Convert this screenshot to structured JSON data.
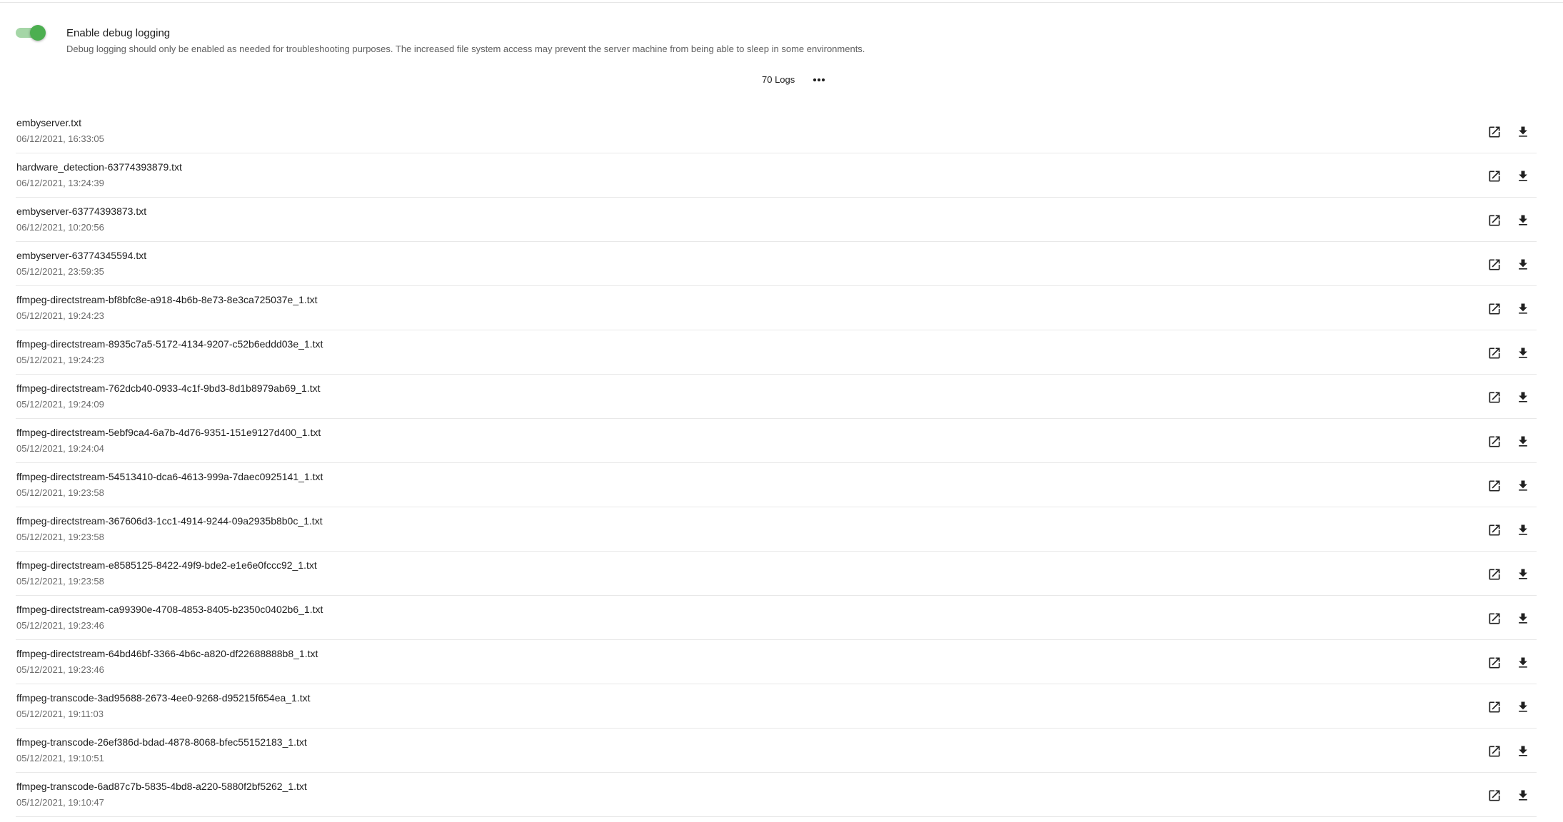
{
  "debug": {
    "enabled": true,
    "label": "Enable debug logging",
    "help": "Debug logging should only be enabled as needed for troubleshooting purposes. The increased file system access may prevent the server machine from being able to sleep in some environments."
  },
  "logs_header": {
    "count_label": "70 Logs",
    "more_icon": "more-horizontal-icon"
  },
  "colors": {
    "toggle_on": "#4caf50",
    "toggle_track": "#a5d6a7"
  },
  "row_icons": {
    "open": "open-in-new-icon",
    "download": "download-icon"
  },
  "logs": [
    {
      "name": "embyserver.txt",
      "date": "06/12/2021, 16:33:05"
    },
    {
      "name": "hardware_detection-63774393879.txt",
      "date": "06/12/2021, 13:24:39"
    },
    {
      "name": "embyserver-63774393873.txt",
      "date": "06/12/2021, 10:20:56"
    },
    {
      "name": "embyserver-63774345594.txt",
      "date": "05/12/2021, 23:59:35"
    },
    {
      "name": "ffmpeg-directstream-bf8bfc8e-a918-4b6b-8e73-8e3ca725037e_1.txt",
      "date": "05/12/2021, 19:24:23"
    },
    {
      "name": "ffmpeg-directstream-8935c7a5-5172-4134-9207-c52b6eddd03e_1.txt",
      "date": "05/12/2021, 19:24:23"
    },
    {
      "name": "ffmpeg-directstream-762dcb40-0933-4c1f-9bd3-8d1b8979ab69_1.txt",
      "date": "05/12/2021, 19:24:09"
    },
    {
      "name": "ffmpeg-directstream-5ebf9ca4-6a7b-4d76-9351-151e9127d400_1.txt",
      "date": "05/12/2021, 19:24:04"
    },
    {
      "name": "ffmpeg-directstream-54513410-dca6-4613-999a-7daec0925141_1.txt",
      "date": "05/12/2021, 19:23:58"
    },
    {
      "name": "ffmpeg-directstream-367606d3-1cc1-4914-9244-09a2935b8b0c_1.txt",
      "date": "05/12/2021, 19:23:58"
    },
    {
      "name": "ffmpeg-directstream-e8585125-8422-49f9-bde2-e1e6e0fccc92_1.txt",
      "date": "05/12/2021, 19:23:58"
    },
    {
      "name": "ffmpeg-directstream-ca99390e-4708-4853-8405-b2350c0402b6_1.txt",
      "date": "05/12/2021, 19:23:46"
    },
    {
      "name": "ffmpeg-directstream-64bd46bf-3366-4b6c-a820-df22688888b8_1.txt",
      "date": "05/12/2021, 19:23:46"
    },
    {
      "name": "ffmpeg-transcode-3ad95688-2673-4ee0-9268-d95215f654ea_1.txt",
      "date": "05/12/2021, 19:11:03"
    },
    {
      "name": "ffmpeg-transcode-26ef386d-bdad-4878-8068-bfec55152183_1.txt",
      "date": "05/12/2021, 19:10:51"
    },
    {
      "name": "ffmpeg-transcode-6ad87c7b-5835-4bd8-a220-5880f2bf5262_1.txt",
      "date": "05/12/2021, 19:10:47"
    }
  ]
}
